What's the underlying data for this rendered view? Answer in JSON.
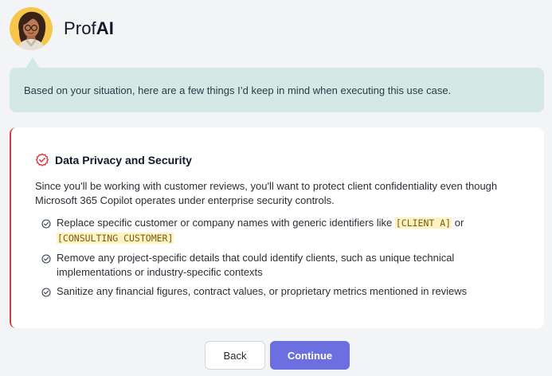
{
  "header": {
    "brand_prefix": "Prof",
    "brand_suffix": "AI",
    "avatar_icon": "woman-avatar-icon"
  },
  "bubble": {
    "text": "Based on your situation, here are a few things I’d keep in mind when executing this use case."
  },
  "card": {
    "accent_color": "#d93a3a",
    "icon": "shield-check-icon",
    "title": "Data Privacy and Security",
    "intro": "Since you'll be working with customer reviews, you'll want to protect client confidentiality even though Microsoft 365 Copilot operates under enterprise security controls.",
    "items": [
      {
        "icon": "check-circle-icon",
        "text_before": "Replace specific customer or company names with generic identifiers like ",
        "code1": "[CLIENT A]",
        "text_middle": " or ",
        "code2": "[CONSULTING CUSTOMER]"
      },
      {
        "icon": "check-circle-icon",
        "text": "Remove any project-specific details that could identify clients, such as unique technical implementations or industry-specific contexts"
      },
      {
        "icon": "check-circle-icon",
        "text": "Sanitize any financial figures, contract values, or proprietary metrics mentioned in reviews"
      }
    ]
  },
  "actions": {
    "back_label": "Back",
    "continue_label": "Continue",
    "primary_color": "#6b6fdf"
  }
}
